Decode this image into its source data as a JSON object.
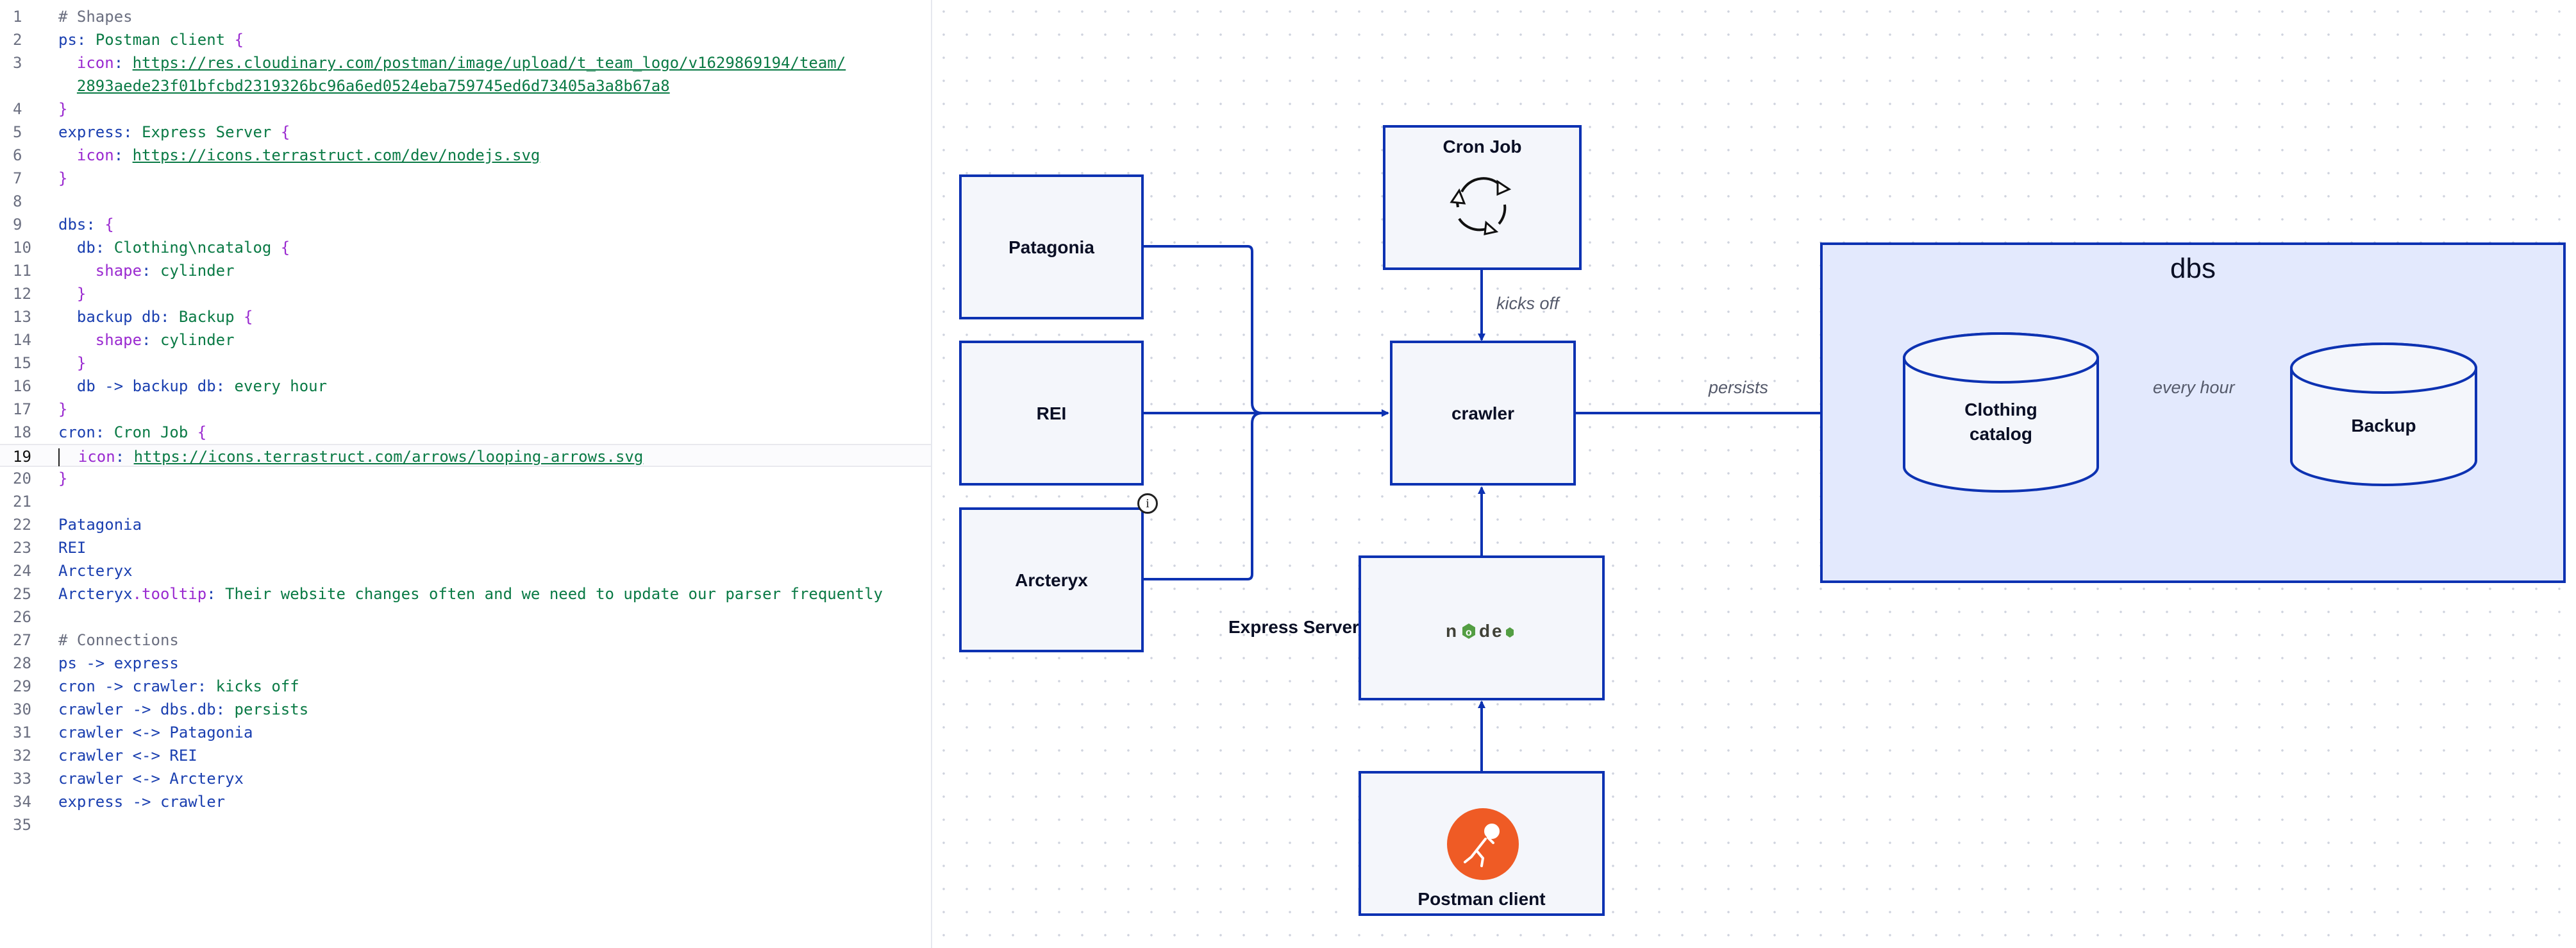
{
  "editor": {
    "active_line": 19,
    "lines": [
      {
        "n": "1",
        "parts": [
          {
            "t": "# Shapes",
            "c": "c"
          }
        ]
      },
      {
        "n": "2",
        "parts": [
          {
            "t": "ps",
            "c": "k"
          },
          {
            "t": ": ",
            "c": "k"
          },
          {
            "t": "Postman client ",
            "c": "s"
          },
          {
            "t": "{",
            "c": "p"
          }
        ]
      },
      {
        "n": "3",
        "parts": [
          {
            "t": "  icon",
            "c": "p"
          },
          {
            "t": ": ",
            "c": "k"
          },
          {
            "t": "https://res.cloudinary.com/postman/image/upload/t_team_logo/v1629869194/team/",
            "c": "u"
          }
        ]
      },
      {
        "n": "",
        "parts": [
          {
            "t": "  ",
            "c": "k"
          },
          {
            "t": "2893aede23f01bfcbd2319326bc96a6ed0524eba759745ed6d73405a3a8b67a8",
            "c": "u"
          }
        ]
      },
      {
        "n": "4",
        "parts": [
          {
            "t": "}",
            "c": "p"
          }
        ]
      },
      {
        "n": "5",
        "parts": [
          {
            "t": "express",
            "c": "k"
          },
          {
            "t": ": ",
            "c": "k"
          },
          {
            "t": "Express Server ",
            "c": "s"
          },
          {
            "t": "{",
            "c": "p"
          }
        ]
      },
      {
        "n": "6",
        "parts": [
          {
            "t": "  icon",
            "c": "p"
          },
          {
            "t": ": ",
            "c": "k"
          },
          {
            "t": "https://icons.terrastruct.com/dev/nodejs.svg",
            "c": "u"
          }
        ]
      },
      {
        "n": "7",
        "parts": [
          {
            "t": "}",
            "c": "p"
          }
        ]
      },
      {
        "n": "8",
        "parts": []
      },
      {
        "n": "9",
        "parts": [
          {
            "t": "dbs",
            "c": "k"
          },
          {
            "t": ": ",
            "c": "k"
          },
          {
            "t": "{",
            "c": "p"
          }
        ]
      },
      {
        "n": "10",
        "parts": [
          {
            "t": "  db",
            "c": "k"
          },
          {
            "t": ": ",
            "c": "k"
          },
          {
            "t": "Clothing\\ncatalog ",
            "c": "s"
          },
          {
            "t": "{",
            "c": "p"
          }
        ]
      },
      {
        "n": "11",
        "parts": [
          {
            "t": "    shape",
            "c": "p"
          },
          {
            "t": ": ",
            "c": "k"
          },
          {
            "t": "cylinder",
            "c": "s"
          }
        ]
      },
      {
        "n": "12",
        "parts": [
          {
            "t": "  }",
            "c": "p"
          }
        ]
      },
      {
        "n": "13",
        "parts": [
          {
            "t": "  backup db",
            "c": "k"
          },
          {
            "t": ": ",
            "c": "k"
          },
          {
            "t": "Backup ",
            "c": "s"
          },
          {
            "t": "{",
            "c": "p"
          }
        ]
      },
      {
        "n": "14",
        "parts": [
          {
            "t": "    shape",
            "c": "p"
          },
          {
            "t": ": ",
            "c": "k"
          },
          {
            "t": "cylinder",
            "c": "s"
          }
        ]
      },
      {
        "n": "15",
        "parts": [
          {
            "t": "  }",
            "c": "p"
          }
        ]
      },
      {
        "n": "16",
        "parts": [
          {
            "t": "  db -> backup db",
            "c": "k"
          },
          {
            "t": ": ",
            "c": "k"
          },
          {
            "t": "every hour",
            "c": "s"
          }
        ]
      },
      {
        "n": "17",
        "parts": [
          {
            "t": "}",
            "c": "p"
          }
        ]
      },
      {
        "n": "18",
        "parts": [
          {
            "t": "cron",
            "c": "k"
          },
          {
            "t": ": ",
            "c": "k"
          },
          {
            "t": "Cron Job ",
            "c": "s"
          },
          {
            "t": "{",
            "c": "p"
          }
        ]
      },
      {
        "n": "19",
        "parts": [
          {
            "t": "  icon",
            "c": "p"
          },
          {
            "t": ": ",
            "c": "k"
          },
          {
            "t": "https://icons.terrastruct.com/arrows/looping-arrows.svg",
            "c": "u"
          }
        ]
      },
      {
        "n": "20",
        "parts": [
          {
            "t": "}",
            "c": "p"
          }
        ]
      },
      {
        "n": "21",
        "parts": []
      },
      {
        "n": "22",
        "parts": [
          {
            "t": "Patagonia",
            "c": "k"
          }
        ]
      },
      {
        "n": "23",
        "parts": [
          {
            "t": "REI",
            "c": "k"
          }
        ]
      },
      {
        "n": "24",
        "parts": [
          {
            "t": "Arcteryx",
            "c": "k"
          }
        ]
      },
      {
        "n": "25",
        "parts": [
          {
            "t": "Arcteryx",
            "c": "k"
          },
          {
            "t": ".tooltip",
            "c": "p"
          },
          {
            "t": ": ",
            "c": "k"
          },
          {
            "t": "Their website changes often and we need to update our parser frequently",
            "c": "s"
          }
        ]
      },
      {
        "n": "26",
        "parts": []
      },
      {
        "n": "27",
        "parts": [
          {
            "t": "# Connections",
            "c": "c"
          }
        ]
      },
      {
        "n": "28",
        "parts": [
          {
            "t": "ps -> express",
            "c": "k"
          }
        ]
      },
      {
        "n": "29",
        "parts": [
          {
            "t": "cron -> crawler",
            "c": "k"
          },
          {
            "t": ": ",
            "c": "k"
          },
          {
            "t": "kicks off",
            "c": "s"
          }
        ]
      },
      {
        "n": "30",
        "parts": [
          {
            "t": "crawler -> dbs.db",
            "c": "k"
          },
          {
            "t": ": ",
            "c": "k"
          },
          {
            "t": "persists",
            "c": "s"
          }
        ]
      },
      {
        "n": "31",
        "parts": [
          {
            "t": "crawler <-> Patagonia",
            "c": "k"
          }
        ]
      },
      {
        "n": "32",
        "parts": [
          {
            "t": "crawler <-> REI",
            "c": "k"
          }
        ]
      },
      {
        "n": "33",
        "parts": [
          {
            "t": "crawler <-> Arcteryx",
            "c": "k"
          }
        ]
      },
      {
        "n": "34",
        "parts": [
          {
            "t": "express -> crawler",
            "c": "k"
          }
        ]
      },
      {
        "n": "35",
        "parts": []
      }
    ]
  },
  "diagram": {
    "nodes": {
      "patagonia": "Patagonia",
      "rei": "REI",
      "arcteryx": "Arcteryx",
      "cron": "Cron Job",
      "crawler": "crawler",
      "express": "Express Server",
      "postman": "Postman client",
      "dbs": "dbs",
      "clothing_catalog_line1": "Clothing",
      "clothing_catalog_line2": "catalog",
      "backup": "Backup"
    },
    "edges": {
      "kicks_off": "kicks off",
      "persists": "persists",
      "every_hour": "every hour"
    },
    "icons": {
      "cron": "looping-arrows-icon",
      "express": "nodejs-icon",
      "postman": "postman-logo-icon",
      "tooltip": "info-icon"
    },
    "colors": {
      "stroke": "#0d32b2",
      "node_fill": "#f4f6fb",
      "container_fill": "#e3e9fd",
      "postman_orange": "#ef5b25",
      "node_green": "#539e43"
    }
  }
}
